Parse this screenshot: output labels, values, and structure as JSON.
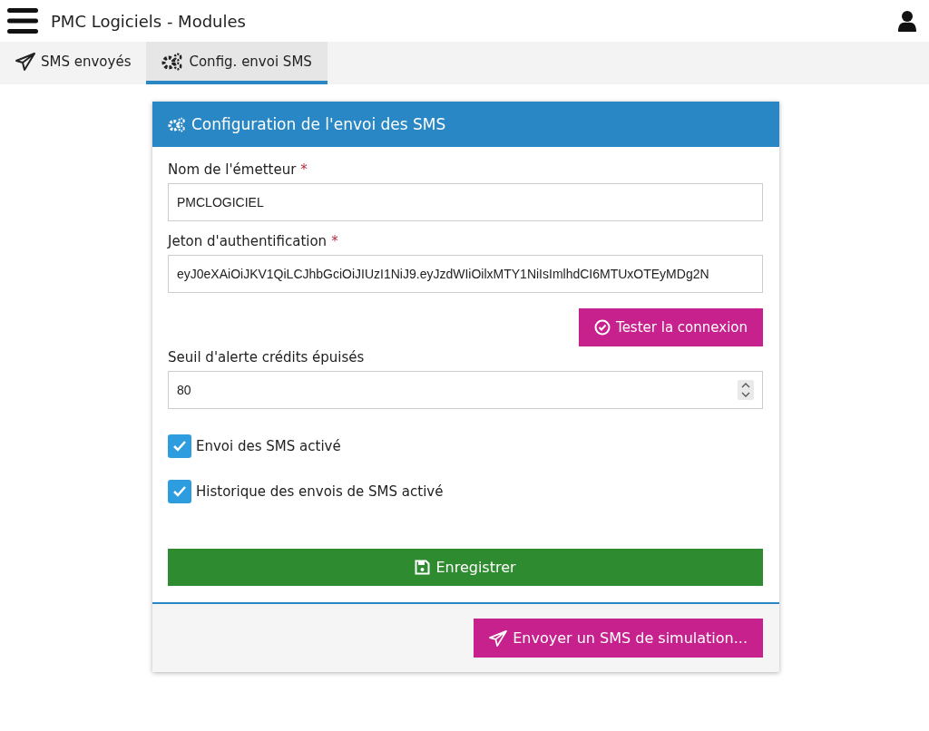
{
  "app_bar": {
    "title": "PMC Logiciels - Modules"
  },
  "tabs": [
    {
      "label": "SMS envoyés",
      "selected": false
    },
    {
      "label": "Config. envoi SMS",
      "selected": true
    }
  ],
  "card": {
    "title": "Configuration de l'envoi des SMS",
    "fields": [
      {
        "label": "Nom de l'émetteur",
        "required_mark": "*",
        "value": "PMCLOGICIEL",
        "kind": "text"
      },
      {
        "label": "Jeton d'authentification",
        "required_mark": "*",
        "value": "eyJ0eXAiOiJKV1QiLCJhbGciOiJIUzI1NiJ9.eyJzdWIiOilxMTY1NiIsImlhdCI6MTUxOTEyMDg2N",
        "kind": "text",
        "action": "Tester la connexion"
      },
      {
        "label": "Seuil d'alerte crédits épuisés",
        "value": "80",
        "kind": "number"
      }
    ],
    "checkboxes": [
      {
        "label": "Envoi des SMS activé",
        "checked": true
      },
      {
        "label": "Historique des envois de SMS activé",
        "checked": true
      }
    ],
    "save_button": "Enregistrer",
    "footer_button": "Envoyer un SMS de simulation..."
  }
}
